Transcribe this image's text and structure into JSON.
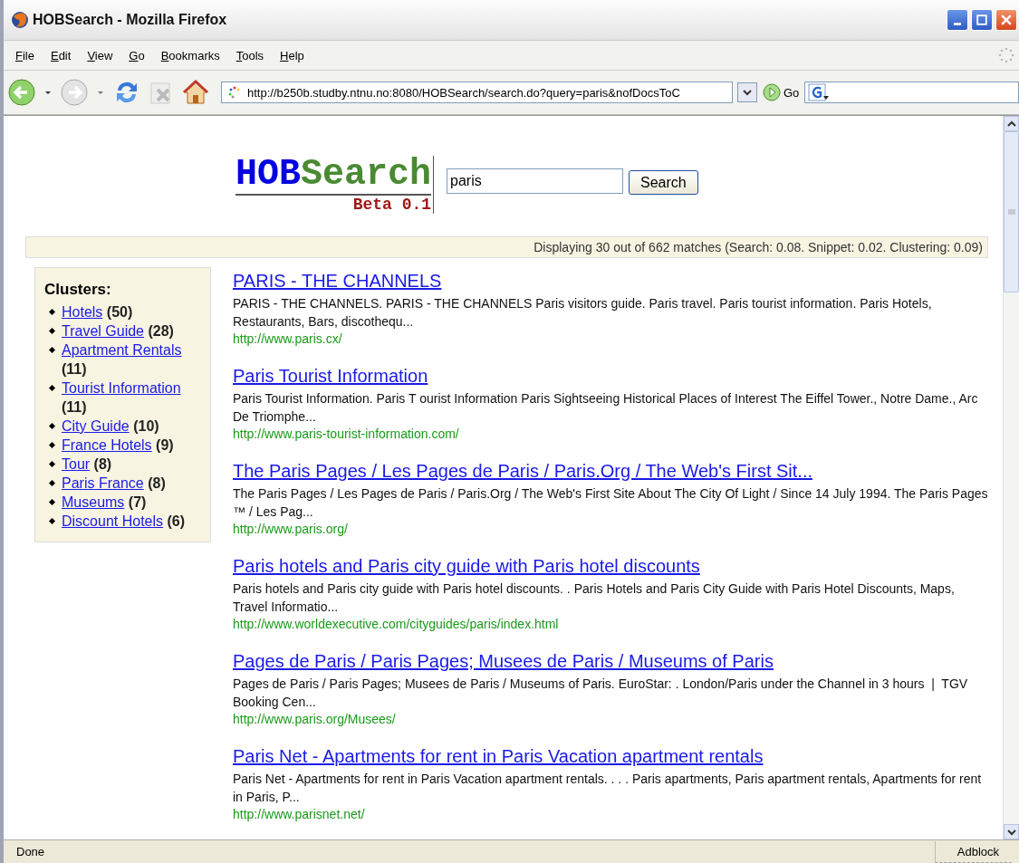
{
  "window": {
    "title": "HOBSearch - Mozilla Firefox"
  },
  "menu": [
    "File",
    "Edit",
    "View",
    "Go",
    "Bookmarks",
    "Tools",
    "Help"
  ],
  "toolbar": {
    "address": "http://b250b.studby.ntnu.no:8080/HOBSearch/search.do?query=paris&nofDocsToC",
    "go": "Go"
  },
  "logo": {
    "part_1": "HOB",
    "part_2": "Search",
    "version": "Beta 0.1"
  },
  "search": {
    "value": "paris",
    "button": "Search"
  },
  "info": "Displaying 30 out of 662 matches (Search: 0.08. Snippet: 0.02. Clustering: 0.09)",
  "clusters": {
    "heading": "Clusters:",
    "items": [
      {
        "label": "Hotels",
        "count": "(50)"
      },
      {
        "label": "Travel Guide",
        "count": "(28)"
      },
      {
        "label": "Apartment Rentals",
        "count": "(11)"
      },
      {
        "label": "Tourist Information",
        "count": "(11)"
      },
      {
        "label": "City Guide",
        "count": "(10)"
      },
      {
        "label": "France Hotels",
        "count": "(9)"
      },
      {
        "label": "Tour",
        "count": "(8)"
      },
      {
        "label": "Paris France",
        "count": "(8)"
      },
      {
        "label": "Museums",
        "count": "(7)"
      },
      {
        "label": "Discount Hotels",
        "count": "(6)"
      }
    ]
  },
  "results": [
    {
      "title": "PARIS - THE CHANNELS",
      "snippet": "PARIS - THE CHANNELS. PARIS - THE CHANNELS Paris visitors guide. Paris travel. Paris tourist information. Paris Hotels, Restaurants, Bars, discothequ...",
      "url": "http://www.paris.cx/"
    },
    {
      "title": "Paris Tourist Information",
      "snippet": "Paris Tourist Information. Paris T ourist Information Paris Sightseeing Historical Places of Interest The Eiffel Tower., Notre Dame., Arc De Triomphe...",
      "url": "http://www.paris-tourist-information.com/"
    },
    {
      "title": "The Paris Pages / Les Pages de Paris / Paris.Org / The Web's First Sit...",
      "snippet": "The Paris Pages / Les Pages de Paris / Paris.Org / The Web's First Site About The City Of Light / Since 14 July 1994. The Paris Pages ™ / Les Pag...",
      "url": "http://www.paris.org/"
    },
    {
      "title": "Paris hotels and Paris city guide with Paris hotel discounts",
      "snippet": "Paris hotels and Paris city guide with Paris hotel discounts. . Paris Hotels and Paris City Guide with Paris Hotel Discounts, Maps, Travel Informatio...",
      "url": "http://www.worldexecutive.com/cityguides/paris/index.html"
    },
    {
      "title": "Pages de Paris / Paris Pages; Musees de Paris / Museums of Paris",
      "snippet": "Pages de Paris / Paris Pages; Musees de Paris / Museums of Paris. EuroStar: . London/Paris under the Channel in 3 hours  |  TGV Booking Cen...",
      "url": "http://www.paris.org/Musees/"
    },
    {
      "title": "Paris Net - Apartments for rent in Paris Vacation apartment rentals",
      "snippet": "Paris Net - Apartments for rent in Paris Vacation apartment rentals. . . . Paris apartments, Paris apartment rentals, Apartments for rent in Paris, P...",
      "url": "http://www.parisnet.net/"
    }
  ],
  "status_bar": {
    "text": "Done",
    "addon": "Adblock"
  }
}
